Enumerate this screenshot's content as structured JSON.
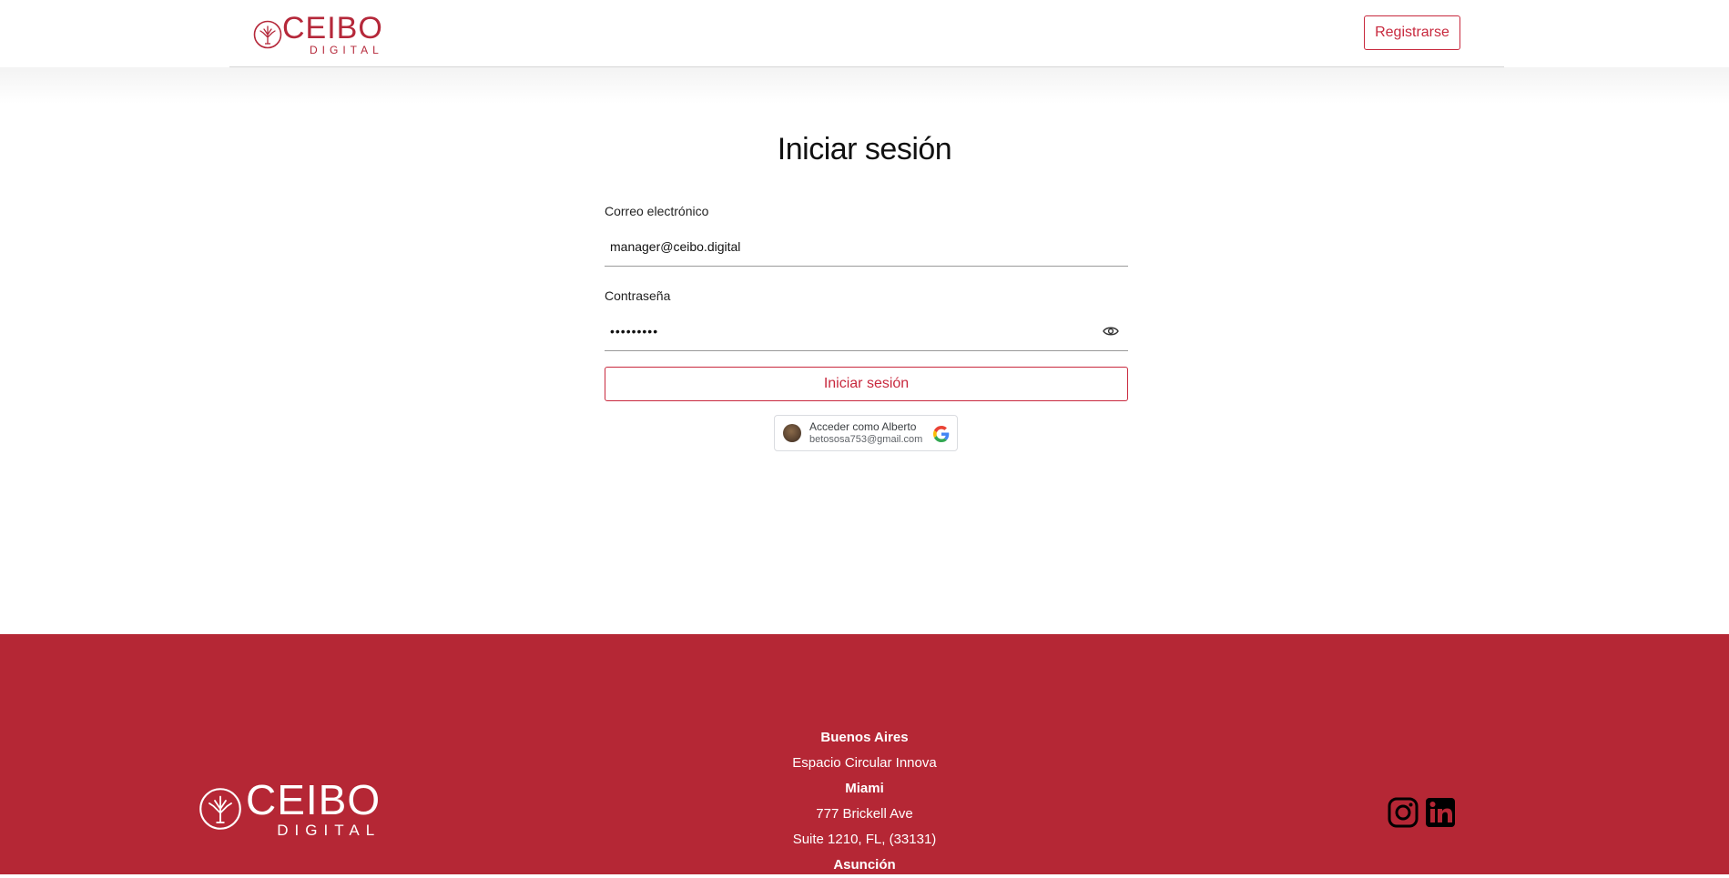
{
  "header": {
    "logo_text": "CEIBO",
    "logo_sub": "DIGITAL",
    "register_label": "Registrarse"
  },
  "main": {
    "title": "Iniciar sesión",
    "email_label": "Correo electrónico",
    "email_value": "manager@ceibo.digital",
    "password_label": "Contraseña",
    "password_value": "•••••••••",
    "login_label": "Iniciar sesión"
  },
  "google": {
    "name": "Acceder como Alberto",
    "email": "betososa753@gmail.com"
  },
  "footer": {
    "logo_text": "CEIBO",
    "logo_sub": "DIGITAL",
    "addresses": [
      {
        "text": "Buenos Aires",
        "type": "city"
      },
      {
        "text": "Espacio Circular Innova",
        "type": "line"
      },
      {
        "text": "Miami",
        "type": "city"
      },
      {
        "text": "777 Brickell Ave",
        "type": "line"
      },
      {
        "text": "Suite 1210, FL, (33131)",
        "type": "line"
      },
      {
        "text": "Asunción",
        "type": "city"
      }
    ]
  },
  "icons": {
    "logo": "ceibo-tree-icon",
    "password_toggle": "eye-icon",
    "google": "google-g-icon",
    "instagram": "instagram-icon",
    "linkedin": "linkedin-icon"
  },
  "colors": {
    "brand_red": "#b5283a",
    "button_red": "#c8293e",
    "footer_bg": "#b52735"
  }
}
